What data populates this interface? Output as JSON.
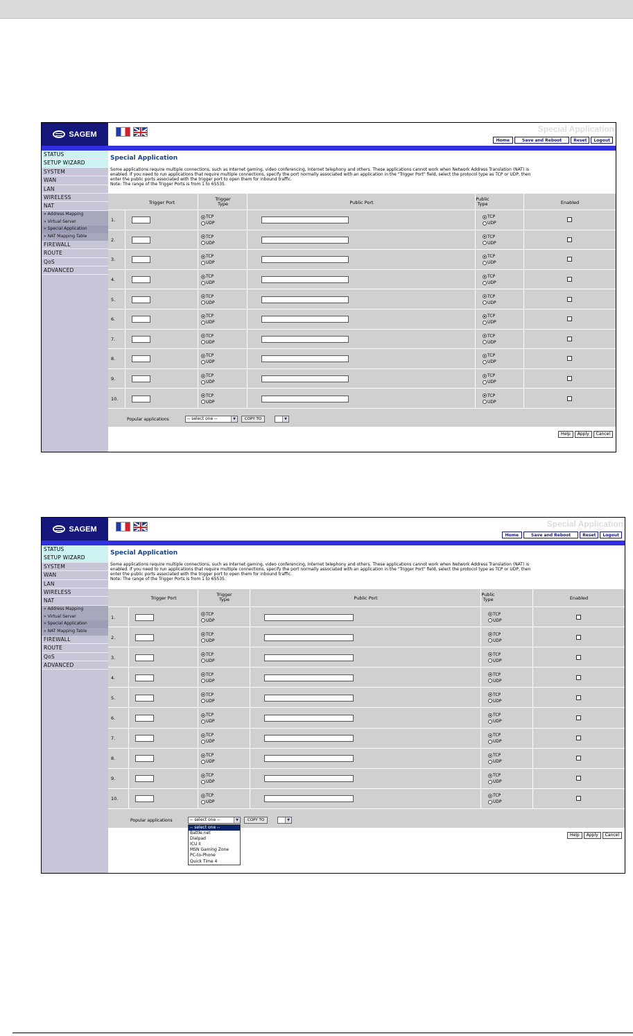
{
  "header": {
    "brand": "SAGEM",
    "page_heading": "Special Application",
    "nav_buttons": [
      "Home",
      "Save and Reboot",
      "Reset",
      "Logout"
    ]
  },
  "sidebar": {
    "items": [
      "STATUS",
      "SETUP WIZARD",
      "SYSTEM",
      "WAN",
      "LAN",
      "WIRELESS",
      "NAT"
    ],
    "nat_subitems": [
      "» Address Mapping",
      "» Virtual Server",
      "» Special Application",
      "» NAT Mapping Table"
    ],
    "items_after": [
      "FIREWALL",
      "ROUTE",
      "QoS",
      "ADVANCED"
    ]
  },
  "main": {
    "title": "Special Application",
    "description": [
      "Some applications require multiple connections, such as Internet gaming, video conferencing, Internet telephony and others. These applications cannot work when Network Address Translation (NAT) is",
      "enabled. If you need to run applications that require multiple connections, specify the port normally associated with an application in the \"Trigger Port\" field, select the protocol type as TCP or UDP, then",
      "enter the public ports associated with the trigger port to open them for inbound traffic.",
      "Note: The range of the Trigger Ports is from 1 to 65535."
    ],
    "table": {
      "headers": {
        "trigger_port": "Trigger Port",
        "trigger_type_1": "Trigger",
        "trigger_type_2": "Type",
        "public_port": "Public Port",
        "public_type_1": "Public",
        "public_type_2": "Type",
        "enabled": "Enabled"
      },
      "rows": [
        "1.",
        "2.",
        "3.",
        "4.",
        "5.",
        "6.",
        "7.",
        "8.",
        "9.",
        "10."
      ],
      "protocol_tcp": "TCP",
      "protocol_udp": "UDP"
    },
    "popular": {
      "label": "Popular applications",
      "selected": "-- select one --",
      "copy_button": "COPY TO",
      "options": [
        "-- select one --",
        "Battle.net",
        "Dialpad",
        "ICU II",
        "MSN Gaming Zone",
        "PC-to-Phone",
        "Quick Time 4"
      ]
    },
    "actions": [
      "Help",
      "Apply",
      "Cancel"
    ]
  },
  "colors": {
    "brand_navy": "#15187a",
    "band_blue": "#3030e0",
    "title_blue": "#17418a",
    "sidebar_bg": "#c6c6d8",
    "active_bg": "#ccf2f2"
  }
}
